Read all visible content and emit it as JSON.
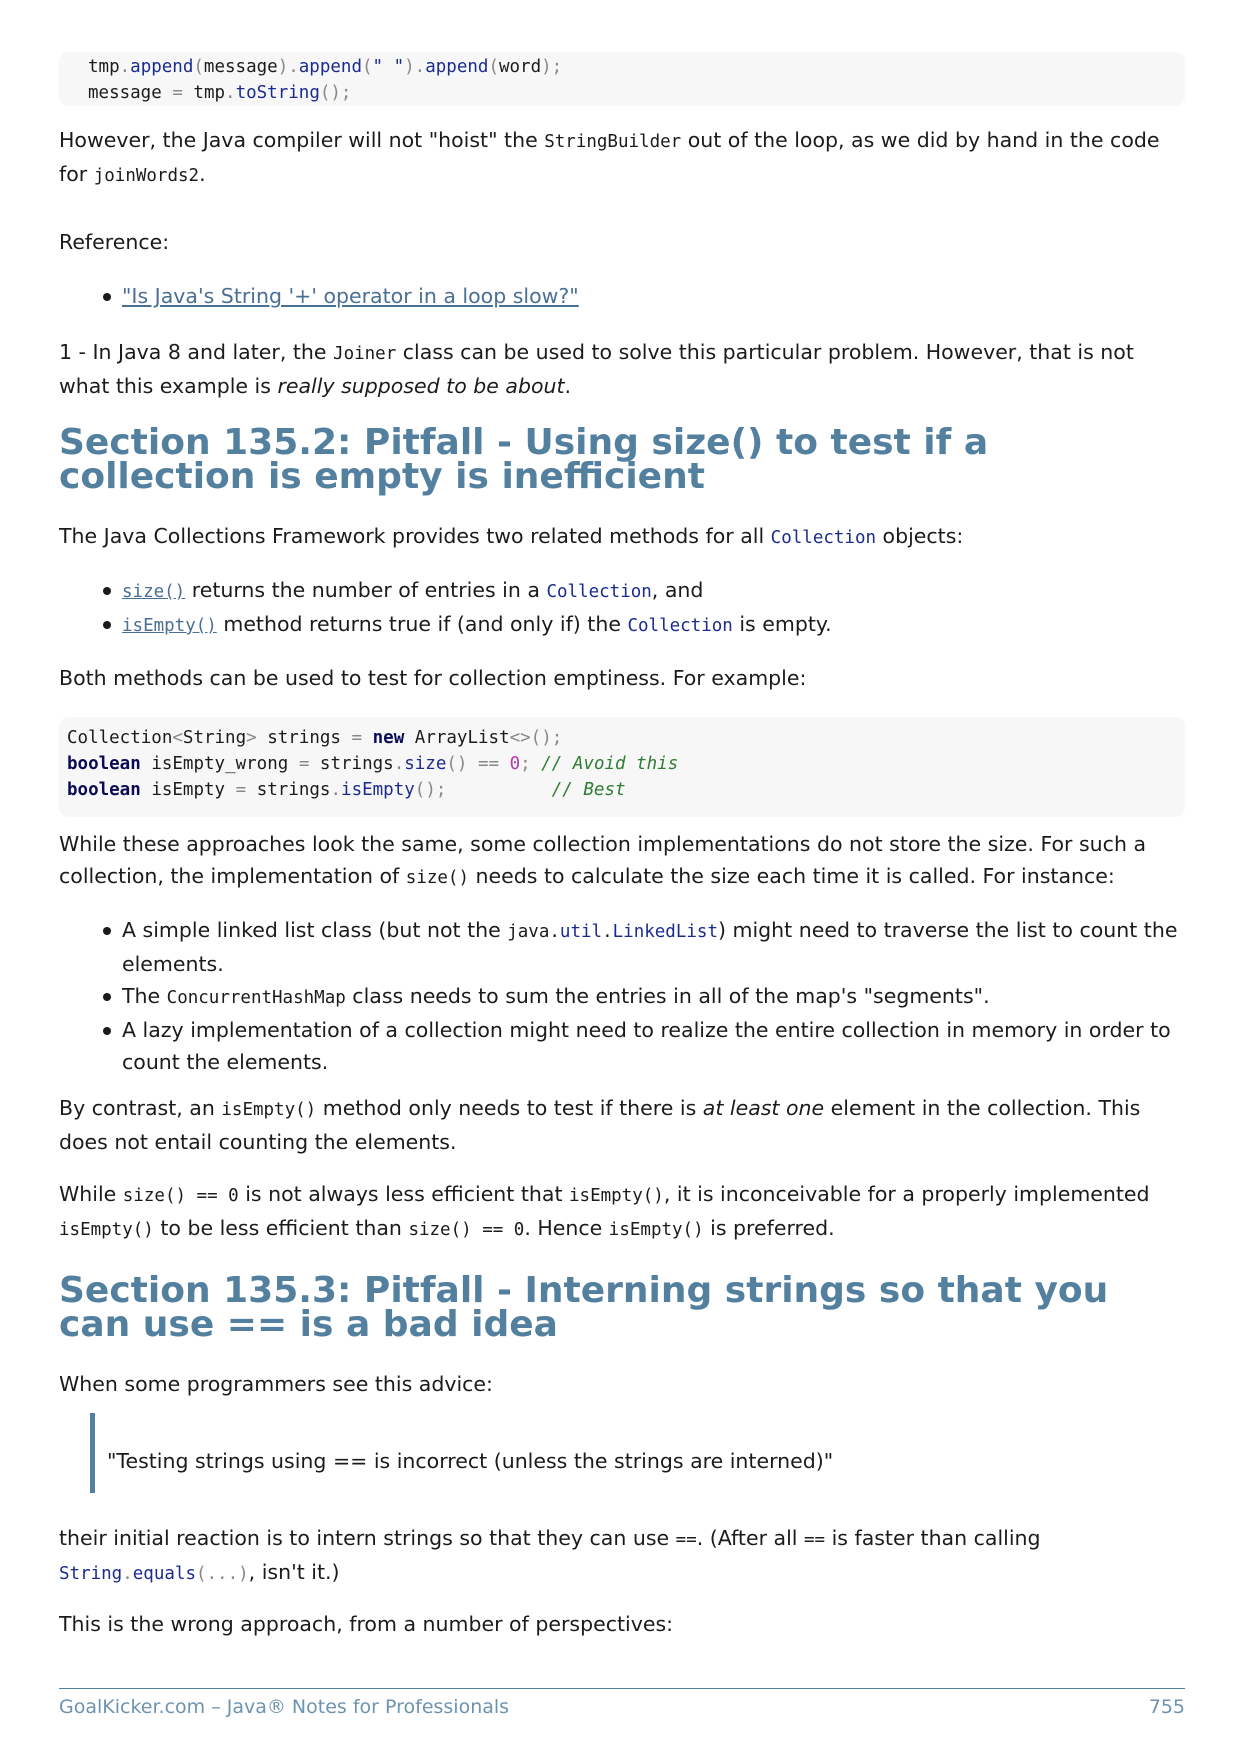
{
  "top_code": {
    "line1": {
      "var": "tmp",
      "m1": "append",
      "a1": "message",
      "m2": "append",
      "str": "\" \"",
      "m3": "append",
      "a3": "word"
    },
    "line2": {
      "lhs": "message",
      "obj": "tmp",
      "m": "toString"
    }
  },
  "para1": {
    "t1": "However, the Java compiler will not \"hoist\" the ",
    "c1": "StringBuilder",
    "t2": " out of the loop, as we did by hand in the code for ",
    "c2": "joinWords2",
    "t3": "."
  },
  "reference_label": "Reference:",
  "reference_link": "\"Is Java's String '+' operator in a loop slow?\"",
  "footnote": {
    "t1": "1 - In Java 8 and later, the ",
    "c1": "Joiner",
    "t2": " class can be used to solve this particular problem. However, that is not what this example is ",
    "em": "really supposed to be about",
    "t3": "."
  },
  "section2": {
    "title": "Section 135.2: Pitfall - Using size() to test if a collection is empty is inefficient",
    "intro_t1": "The Java Collections Framework provides two related methods for all ",
    "intro_c1": "Collection",
    "intro_t2": " objects:",
    "bullets": [
      {
        "link": "size()",
        "t1": " returns the number of entries in a ",
        "c1": "Collection",
        "t2": ", and"
      },
      {
        "link": "isEmpty()",
        "t1": " method returns true if (and only if) the ",
        "c1": "Collection",
        "t2": " is empty."
      }
    ],
    "both": "Both methods can be used to test for collection emptiness. For example:",
    "code": {
      "l1_type": "Collection",
      "l1_generic": "String",
      "l1_var": "strings",
      "l1_new": "new",
      "l1_cls": "ArrayList",
      "l2_kw": "boolean",
      "l2_var": "isEmpty_wrong",
      "l2_obj": "strings",
      "l2_m": "size",
      "l2_num": "0",
      "l2_cm": "// Avoid this",
      "l3_kw": "boolean",
      "l3_var": "isEmpty",
      "l3_obj": "strings",
      "l3_m": "isEmpty",
      "l3_cm": "// Best"
    },
    "while1_t1": "While these approaches look the same, some collection implementations do not store the size. For such a collection, the implementation of ",
    "while1_c1": "size()",
    "while1_t2": " needs to calculate the size each time it is called. For instance:",
    "bullets2": [
      {
        "t1": "A simple linked list class (but not the ",
        "c_pkg": "java.",
        "c_util": "util",
        "c_dot": ".",
        "c_cls": "LinkedList",
        "t2": ") might need to traverse the list to count the elements."
      },
      {
        "t1": "The ",
        "c1": "ConcurrentHashMap",
        "t2": " class needs to sum the entries in all of the map's \"segments\"."
      },
      {
        "t1": "A lazy implementation of a collection might need to realize the entire collection in memory in order to count the elements."
      }
    ],
    "contrast_t1": "By contrast, an ",
    "contrast_c1": "isEmpty()",
    "contrast_t2": " method only needs to test if there is ",
    "contrast_em": "at least one",
    "contrast_t3": " element in the collection. This does not entail counting the elements.",
    "while2_t1": "While ",
    "while2_c1": "size() == 0",
    "while2_t2": " is not always less efficient that ",
    "while2_c2": "isEmpty()",
    "while2_t3": ", it is inconceivable for a properly implemented ",
    "while2_c3": "isEmpty()",
    "while2_t4": " to be less efficient than ",
    "while2_c4": "size() == 0",
    "while2_t5": ". Hence ",
    "while2_c5": "isEmpty()",
    "while2_t6": " is preferred."
  },
  "section3": {
    "title": "Section 135.3: Pitfall - Interning strings so that you can use == is a bad idea",
    "intro": "When some programmers see this advice:",
    "quote": "\"Testing strings using == is incorrect (unless the strings are interned)\"",
    "reaction_t1": "their initial reaction is to intern strings so that they can use ",
    "reaction_c1": "==",
    "reaction_t2": ". (After all ",
    "reaction_c2": "==",
    "reaction_t3": " is faster than calling ",
    "reaction_c3_cls": "String",
    "reaction_c3_m": "equals",
    "reaction_c3_args": "(...)",
    "reaction_t4": ", isn't it.)",
    "wrong": "This is the wrong approach, from a number of perspectives:"
  },
  "footer": {
    "left": "GoalKicker.com – Java® Notes for Professionals",
    "page": "755"
  },
  "colors": {
    "heading": "#54809f",
    "link": "#4a6f95",
    "code_bg": "#f7f7f8"
  }
}
